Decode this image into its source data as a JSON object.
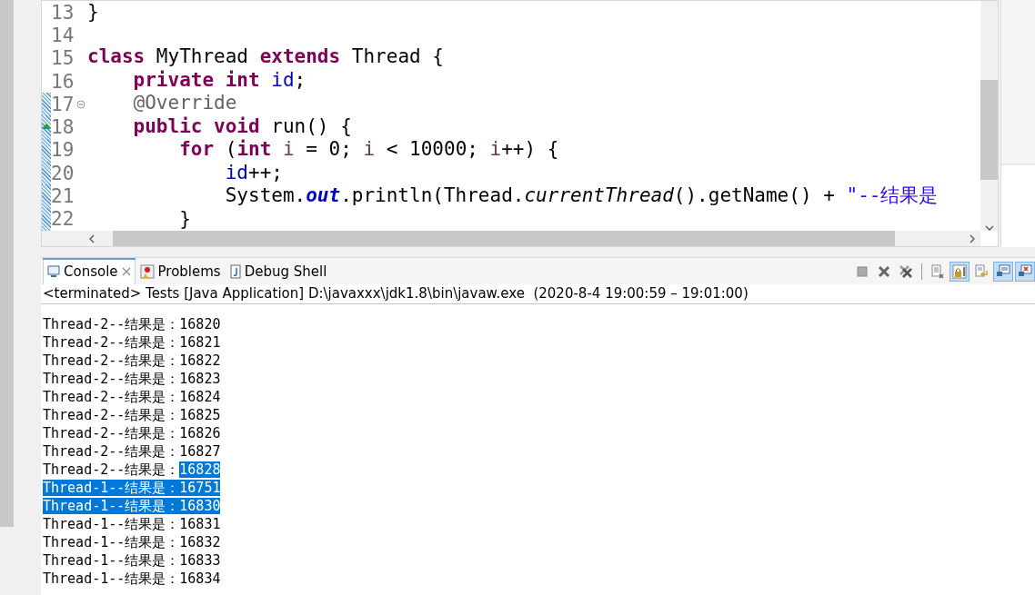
{
  "editor": {
    "lines": [
      {
        "number": "13",
        "fold_marker": false,
        "override_marker": false,
        "changed": false,
        "tokens": [
          {
            "text": "}",
            "kind": "plain"
          }
        ]
      },
      {
        "number": "14",
        "fold_marker": false,
        "override_marker": false,
        "changed": false
      },
      {
        "number": "15",
        "fold_marker": false,
        "override_marker": false,
        "changed": false,
        "tokens": [
          {
            "text": "class",
            "kind": "keyword"
          },
          {
            "text": " MyThread ",
            "kind": "plain"
          },
          {
            "text": "extends",
            "kind": "keyword"
          },
          {
            "text": " Thread {",
            "kind": "plain"
          }
        ]
      },
      {
        "number": "16",
        "fold_marker": false,
        "override_marker": false,
        "changed": false,
        "tokens": [
          {
            "text": "    private",
            "kind": "keyword"
          },
          {
            "text": " int",
            "kind": "keyword"
          },
          {
            "text": " id",
            "kind": "field"
          },
          {
            "text": ";",
            "kind": "plain"
          }
        ]
      },
      {
        "number": "17",
        "fold_marker": true,
        "override_marker": false,
        "changed": true,
        "tokens": [
          {
            "text": "    @Override",
            "kind": "annotation"
          }
        ]
      },
      {
        "number": "18",
        "fold_marker": false,
        "override_marker": true,
        "changed": true,
        "tokens": [
          {
            "text": "    public",
            "kind": "keyword"
          },
          {
            "text": " void",
            "kind": "keyword"
          },
          {
            "text": " run() {",
            "kind": "plain"
          }
        ]
      },
      {
        "number": "19",
        "fold_marker": false,
        "override_marker": false,
        "changed": true,
        "tokens": [
          {
            "text": "        for",
            "kind": "keyword"
          },
          {
            "text": " (",
            "kind": "plain"
          },
          {
            "text": "int",
            "kind": "keyword"
          },
          {
            "text": " i",
            "kind": "local"
          },
          {
            "text": " = 0; ",
            "kind": "plain"
          },
          {
            "text": "i",
            "kind": "local"
          },
          {
            "text": " < 10000; ",
            "kind": "plain"
          },
          {
            "text": "i",
            "kind": "local"
          },
          {
            "text": "++) {",
            "kind": "plain"
          }
        ]
      },
      {
        "number": "20",
        "fold_marker": false,
        "override_marker": false,
        "changed": true,
        "tokens": [
          {
            "text": "            id",
            "kind": "field"
          },
          {
            "text": "++;",
            "kind": "plain"
          }
        ]
      },
      {
        "number": "21",
        "fold_marker": false,
        "override_marker": false,
        "changed": true,
        "tokens": [
          {
            "text": "            System.",
            "kind": "plain"
          },
          {
            "text": "out",
            "kind": "static"
          },
          {
            "text": ".println(Thread.",
            "kind": "plain"
          },
          {
            "text": "currentThread",
            "kind": "static_method"
          },
          {
            "text": "().getName() + ",
            "kind": "plain"
          },
          {
            "text": "\"--结果是",
            "kind": "string"
          }
        ]
      },
      {
        "number": "22",
        "fold_marker": false,
        "override_marker": false,
        "changed": true,
        "tokens": [
          {
            "text": "        }",
            "kind": "plain"
          }
        ]
      }
    ]
  },
  "console": {
    "tabs": [
      {
        "label": "Console",
        "selected": true,
        "closable": true
      },
      {
        "label": "Problems",
        "selected": false,
        "closable": false
      },
      {
        "label": "Debug Shell",
        "selected": false,
        "closable": false
      }
    ],
    "toolbar": [
      {
        "kind": "terminate",
        "pressed": false
      },
      {
        "kind": "remove",
        "pressed": false
      },
      {
        "kind": "remove_all",
        "pressed": false
      },
      {
        "kind": "separator"
      },
      {
        "kind": "clear",
        "pressed": false
      },
      {
        "kind": "scroll_lock",
        "pressed": true
      },
      {
        "kind": "word_wrap",
        "pressed": false
      },
      {
        "kind": "show_out",
        "pressed": true
      },
      {
        "kind": "show_err",
        "pressed": true
      }
    ],
    "status": "<terminated> Tests [Java Application] D:\\javaxxx\\jdk1.8\\bin\\javaw.exe  (2020-8-4 19:00:59 – 19:01:00)",
    "output": [
      {
        "label": "Thread-2--结果是：",
        "value": "16820",
        "label_selected": false,
        "value_selected": false
      },
      {
        "label": "Thread-2--结果是：",
        "value": "16821",
        "label_selected": false,
        "value_selected": false
      },
      {
        "label": "Thread-2--结果是：",
        "value": "16822",
        "label_selected": false,
        "value_selected": false
      },
      {
        "label": "Thread-2--结果是：",
        "value": "16823",
        "label_selected": false,
        "value_selected": false
      },
      {
        "label": "Thread-2--结果是：",
        "value": "16824",
        "label_selected": false,
        "value_selected": false
      },
      {
        "label": "Thread-2--结果是：",
        "value": "16825",
        "label_selected": false,
        "value_selected": false
      },
      {
        "label": "Thread-2--结果是：",
        "value": "16826",
        "label_selected": false,
        "value_selected": false
      },
      {
        "label": "Thread-2--结果是：",
        "value": "16827",
        "label_selected": false,
        "value_selected": false
      },
      {
        "label": "Thread-2--结果是：",
        "value": "16828",
        "label_selected": false,
        "value_selected": true
      },
      {
        "label": "Thread-1--结果是：",
        "value": "16751",
        "label_selected": true,
        "value_selected": true
      },
      {
        "label": "Thread-1--结果是：",
        "value": "16830",
        "label_selected": true,
        "value_selected": true
      },
      {
        "label": "Thread-1--结果是：",
        "value": "16831",
        "label_selected": false,
        "value_selected": false
      },
      {
        "label": "Thread-1--结果是：",
        "value": "16832",
        "label_selected": false,
        "value_selected": false
      },
      {
        "label": "Thread-1--结果是：",
        "value": "16833",
        "label_selected": false,
        "value_selected": false
      },
      {
        "label": "Thread-1--结果是：",
        "value": "16834",
        "label_selected": false,
        "value_selected": false
      }
    ]
  }
}
